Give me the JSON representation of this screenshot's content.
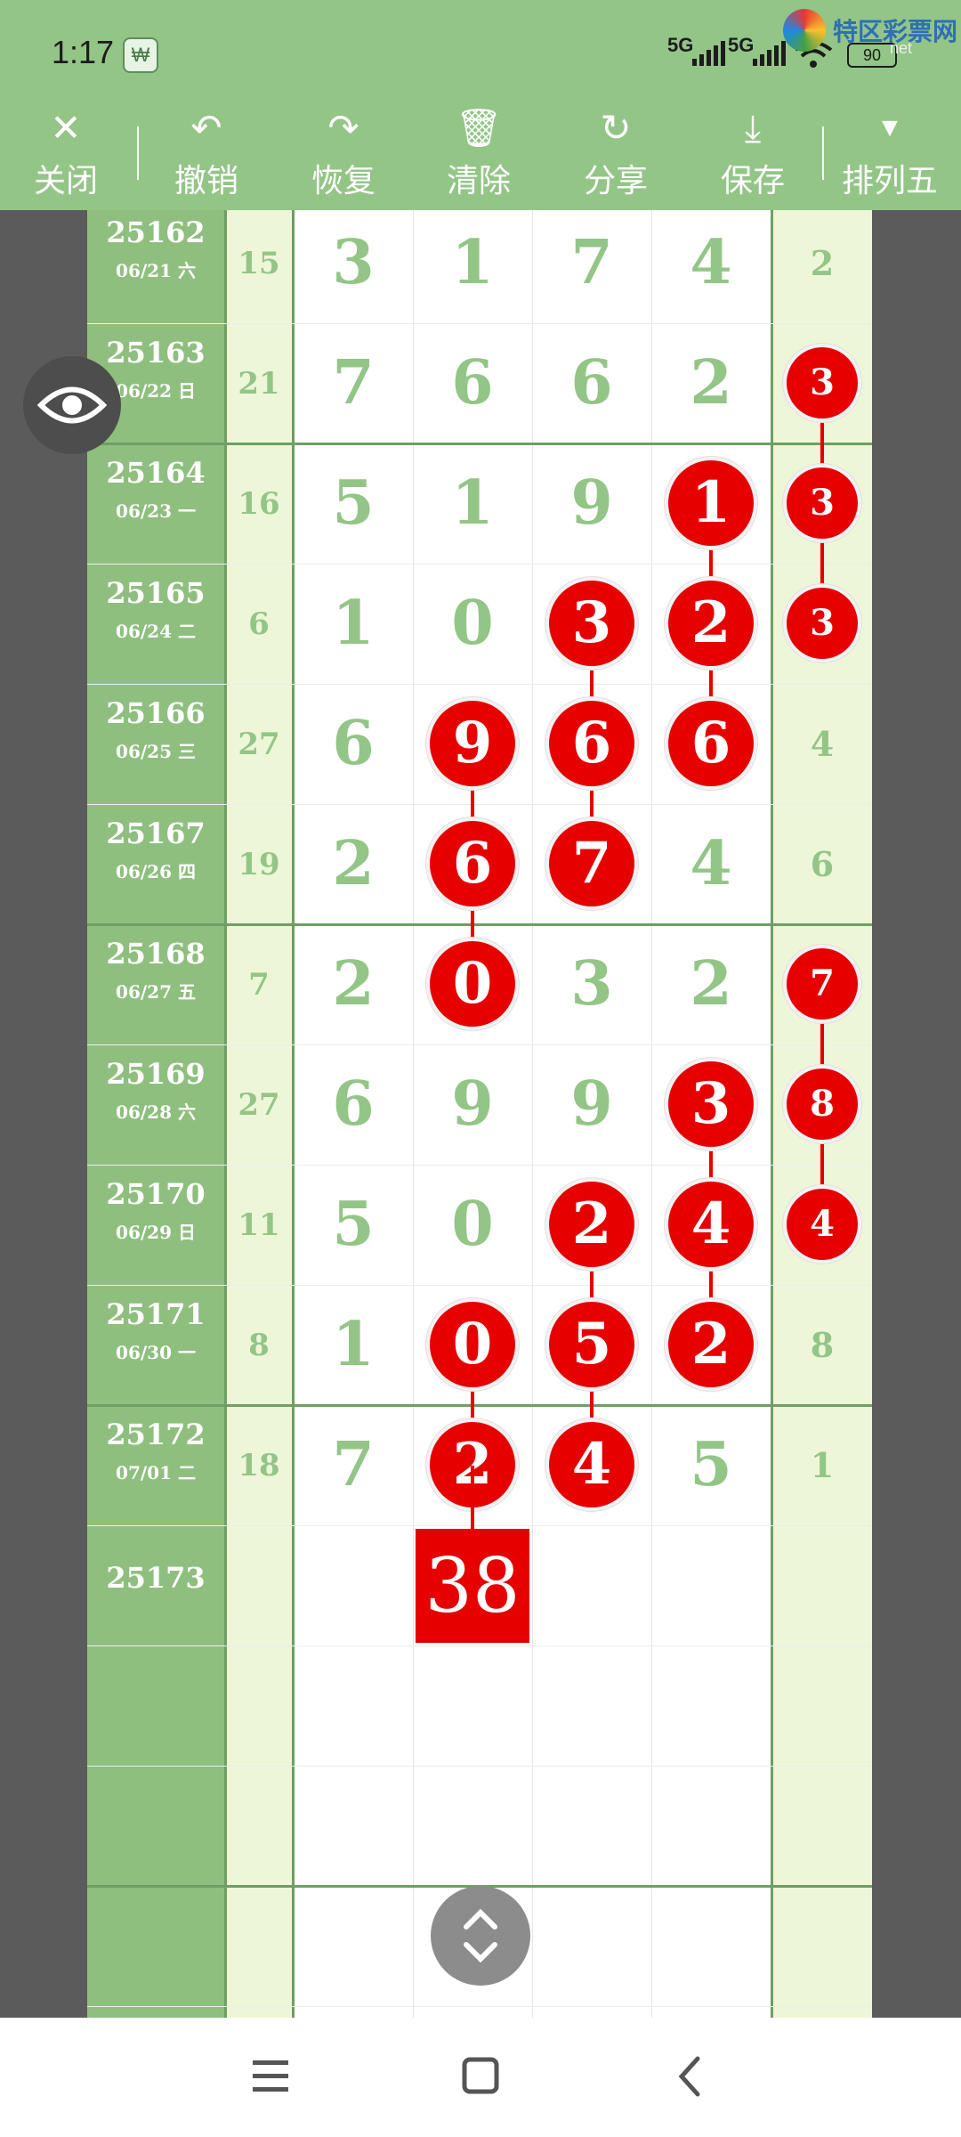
{
  "status": {
    "time": "1:17",
    "app_badge": "₩",
    "net1": "5G",
    "net2": "5G",
    "battery": "90"
  },
  "watermark": {
    "brand": "特区彩票网",
    "url": "net"
  },
  "toolbar": [
    {
      "icon": "✕",
      "label": "关闭",
      "name": "close-button",
      "icon_name": "close-icon"
    },
    {
      "icon": "↶",
      "label": "撤销",
      "name": "undo-button",
      "icon_name": "undo-icon"
    },
    {
      "icon": "↷",
      "label": "恢复",
      "name": "redo-button",
      "icon_name": "redo-icon"
    },
    {
      "icon": "🗑",
      "label": "清除",
      "name": "clear-button",
      "icon_name": "trash-icon"
    },
    {
      "icon": "↻",
      "label": "分享",
      "name": "share-button",
      "icon_name": "share-icon"
    },
    {
      "icon": "⤓",
      "label": "保存",
      "name": "save-button",
      "icon_name": "download-icon"
    },
    {
      "icon": "▼",
      "label": "排列五",
      "name": "lottery-select",
      "icon_name": "dropdown-icon"
    }
  ],
  "rows": [
    {
      "period": "25162",
      "date": "06/21 六",
      "sum": "15",
      "digits": [
        "3",
        "1",
        "7",
        "4"
      ],
      "hits": [
        false,
        false,
        false,
        false
      ],
      "tail": "2",
      "tail_hit": false
    },
    {
      "period": "25163",
      "date": "06/22 日",
      "sum": "21",
      "digits": [
        "7",
        "6",
        "6",
        "2"
      ],
      "hits": [
        false,
        false,
        false,
        false
      ],
      "tail": "3",
      "tail_hit": true
    },
    {
      "period": "25164",
      "date": "06/23 一",
      "sum": "16",
      "digits": [
        "5",
        "1",
        "9",
        "1"
      ],
      "hits": [
        false,
        false,
        false,
        true
      ],
      "tail": "3",
      "tail_hit": true
    },
    {
      "period": "25165",
      "date": "06/24 二",
      "sum": "6",
      "digits": [
        "1",
        "0",
        "3",
        "2"
      ],
      "hits": [
        false,
        false,
        true,
        true
      ],
      "tail": "3",
      "tail_hit": true
    },
    {
      "period": "25166",
      "date": "06/25 三",
      "sum": "27",
      "digits": [
        "6",
        "9",
        "6",
        "6"
      ],
      "hits": [
        false,
        true,
        true,
        true
      ],
      "tail": "4",
      "tail_hit": false
    },
    {
      "period": "25167",
      "date": "06/26 四",
      "sum": "19",
      "digits": [
        "2",
        "6",
        "7",
        "4"
      ],
      "hits": [
        false,
        true,
        true,
        false
      ],
      "tail": "6",
      "tail_hit": false
    },
    {
      "period": "25168",
      "date": "06/27 五",
      "sum": "7",
      "digits": [
        "2",
        "0",
        "3",
        "2"
      ],
      "hits": [
        false,
        true,
        false,
        false
      ],
      "tail": "7",
      "tail_hit": true
    },
    {
      "period": "25169",
      "date": "06/28 六",
      "sum": "27",
      "digits": [
        "6",
        "9",
        "9",
        "3"
      ],
      "hits": [
        false,
        false,
        false,
        true
      ],
      "tail": "8",
      "tail_hit": true
    },
    {
      "period": "25170",
      "date": "06/29 日",
      "sum": "11",
      "digits": [
        "5",
        "0",
        "2",
        "4"
      ],
      "hits": [
        false,
        false,
        true,
        true
      ],
      "tail": "4",
      "tail_hit": true
    },
    {
      "period": "25171",
      "date": "06/30 一",
      "sum": "8",
      "digits": [
        "1",
        "0",
        "5",
        "2"
      ],
      "hits": [
        false,
        true,
        true,
        true
      ],
      "tail": "8",
      "tail_hit": false
    },
    {
      "period": "25172",
      "date": "07/01 二",
      "sum": "18",
      "digits": [
        "7",
        "2",
        "4",
        "5"
      ],
      "hits": [
        false,
        true,
        true,
        false
      ],
      "tail": "1",
      "tail_hit": false
    },
    {
      "period": "25173",
      "date": "",
      "sum": "",
      "digits": [
        "",
        "",
        "",
        ""
      ],
      "hits": [
        false,
        false,
        false,
        false
      ],
      "tail": "",
      "tail_hit": false
    }
  ],
  "prediction": "38",
  "colors": {
    "bg_green": "#93c587",
    "hit_red": "#e60000",
    "pale": "#eef6d8"
  },
  "icons": {
    "eye": "eye-icon",
    "scroll": "scroll-toggle-icon",
    "nav_menu": "menu-icon",
    "nav_home": "home-icon",
    "nav_back": "back-icon"
  }
}
